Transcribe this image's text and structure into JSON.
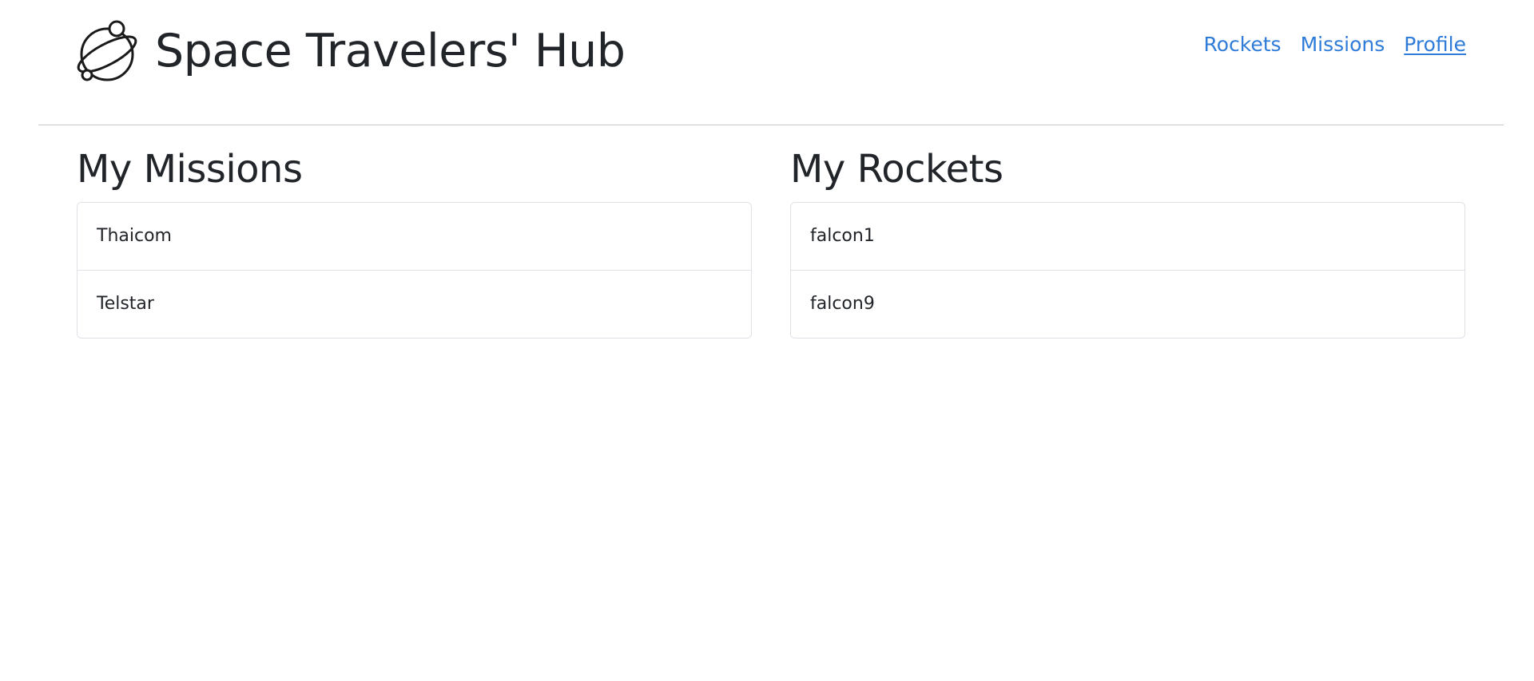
{
  "header": {
    "title": "Space Travelers' Hub",
    "logo_icon": "planet-logo-icon",
    "nav": [
      {
        "label": "Rockets",
        "active": false
      },
      {
        "label": "Missions",
        "active": false
      },
      {
        "label": "Profile",
        "active": true
      }
    ]
  },
  "missions": {
    "heading": "My Missions",
    "items": [
      "Thaicom",
      "Telstar"
    ]
  },
  "rockets": {
    "heading": "My Rockets",
    "items": [
      "falcon1",
      "falcon9"
    ]
  },
  "colors": {
    "link": "#2f7bd8",
    "text": "#212529",
    "border": "#dee2e6"
  }
}
